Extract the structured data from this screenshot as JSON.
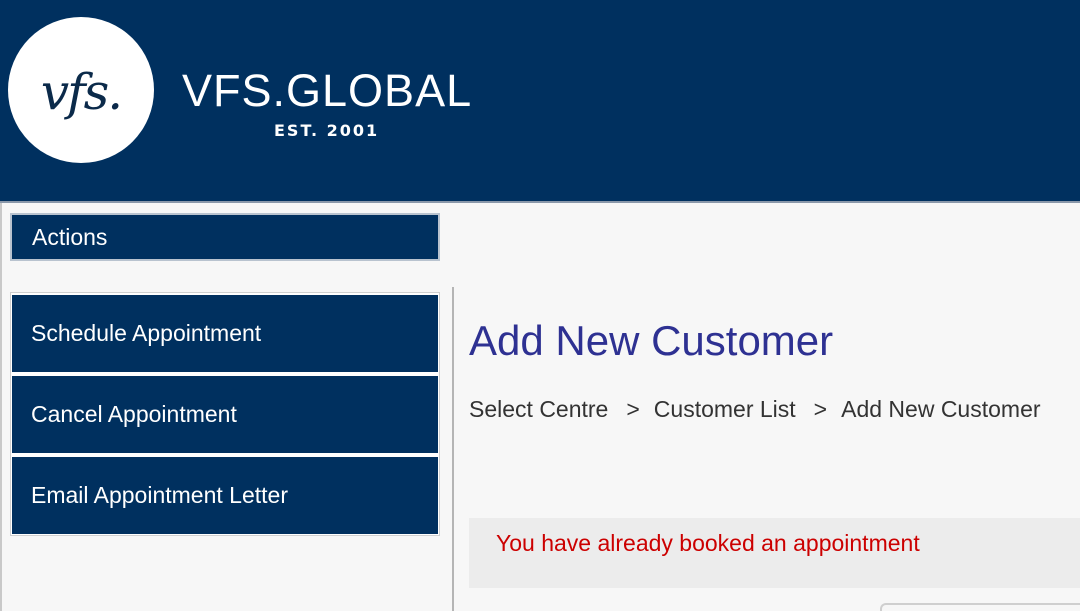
{
  "header": {
    "logo_mark": "vfs.",
    "brand_name": "VFS.GLOBAL",
    "brand_tagline": "EST. 2001",
    "background_color": "#00305f"
  },
  "sidebar": {
    "heading": "Actions",
    "items": [
      {
        "label": "Schedule Appointment"
      },
      {
        "label": "Cancel Appointment"
      },
      {
        "label": "Email Appointment Letter"
      }
    ]
  },
  "main": {
    "title": "Add New Customer",
    "breadcrumb": [
      {
        "label": "Select Centre"
      },
      {
        "label": "Customer List"
      },
      {
        "label": "Add New Customer"
      }
    ],
    "breadcrumb_separator": ">",
    "alert": {
      "message": "You have already booked an appointment",
      "color": "#cc0000"
    }
  }
}
